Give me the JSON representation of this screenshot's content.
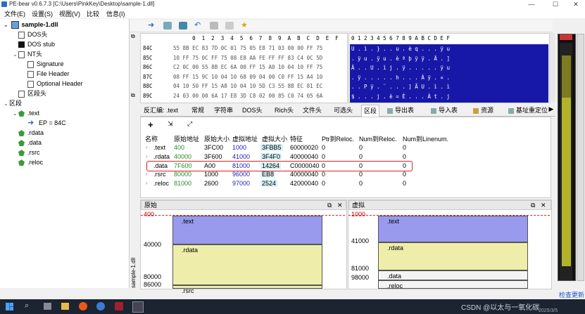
{
  "window": {
    "title": "PE-bear v0.6.7.3 [C:\\Users\\PinkKey\\Desktop\\sample-1.dll]",
    "controls": {
      "minimize": "—",
      "maximize": "☐",
      "close": "✕"
    }
  },
  "menu": [
    "文件(E)",
    "设置(S)",
    "视图(V)",
    "比较",
    "信息(I)"
  ],
  "tree": {
    "root": "sample-1.dll",
    "items": [
      {
        "label": "DOS头",
        "indent": 1,
        "icon": "file",
        "arrow": ""
      },
      {
        "label": "DOS stub",
        "indent": 1,
        "icon": "black",
        "arrow": ""
      },
      {
        "label": "NT头",
        "indent": 1,
        "icon": "file",
        "arrow": "⌄"
      },
      {
        "label": "Signature",
        "indent": 2,
        "icon": "file",
        "arrow": ""
      },
      {
        "label": "File Header",
        "indent": 2,
        "icon": "file",
        "arrow": ""
      },
      {
        "label": "Optional Header",
        "indent": 2,
        "icon": "file",
        "arrow": ""
      },
      {
        "label": "区段头",
        "indent": 1,
        "icon": "file",
        "arrow": ""
      },
      {
        "label": "区段",
        "indent": 0,
        "icon": "none",
        "arrow": "⌄"
      },
      {
        "label": ".text",
        "indent": 1,
        "icon": "green",
        "arrow": "⌄"
      },
      {
        "label": "EP = 84C",
        "indent": 2,
        "icon": "arrow",
        "arrow": ""
      },
      {
        "label": ".rdata",
        "indent": 1,
        "icon": "green",
        "arrow": ""
      },
      {
        "label": ".data",
        "indent": 1,
        "icon": "green",
        "arrow": ""
      },
      {
        "label": ".rsrc",
        "indent": 1,
        "icon": "green",
        "arrow": ""
      },
      {
        "label": ".reloc",
        "indent": 1,
        "icon": "green",
        "arrow": ""
      }
    ]
  },
  "hex": {
    "header": "      0  1  2  3  4  5  6  7  8  9  A  B  C  D  E  F",
    "rows": [
      {
        "addr": "84C",
        "bytes": "55 8B EC 83 7D 0C 01 75 05 E8 71 03 00 00 FF 75"
      },
      {
        "addr": "85C",
        "bytes": "10 FF 75 0C FF 75 08 E8 AA FE FF FF 83 C4 0C 5D"
      },
      {
        "addr": "86C",
        "bytes": "C2 0C 00 55 8B EC 6A 00 FF 15 A0 10 04 10 FF 75"
      },
      {
        "addr": "87C",
        "bytes": "08 FF 15 9C 10 04 10 68 09 04 00 C0 FF 15 A4 10"
      },
      {
        "addr": "88C",
        "bytes": "04 10 50 FF 15 A8 10 04 10 5D C3 55 8B EC 81 EC"
      },
      {
        "addr": "89C",
        "bytes": "24 03 00 00 6A 17 E8 3D C8 02 00 85 C0 74 05 6A"
      }
    ],
    "ascii_header": "0 1 2 3 4 5 6 7 8 9 A B C D E F",
    "ascii_rows": [
      "U . ì . } . . u . è q . . . ÿ u",
      ". ÿ u . ÿ u . è ª þ ÿ ÿ . Ä . ]",
      "Â . . U . ì j . ÿ . . . . . ÿ u",
      ". ÿ . . . . . h . . . À ÿ . ¤ .",
      ". . P ÿ . ¨ . . . ] Ã U . ì . ì",
      "$ . . . j . è = È . . . À t . j"
    ]
  },
  "tabs": [
    "反汇编: .text",
    "常规",
    "字符串",
    "DOS头",
    "Rich头",
    "文件头",
    "可选头",
    "区段",
    "导出表",
    "导入表",
    "资源",
    "基址重定位"
  ],
  "active_tab": "区段",
  "section_table": {
    "columns": [
      "名称",
      "原始地址",
      "原始大小",
      "虚拟地址",
      "虚拟大小",
      "特征",
      "Ptr到Reloc.",
      "Num到Reloc.",
      "Num到Linenum."
    ],
    "rows": [
      [
        ".text",
        "400",
        "3FC00",
        "1000",
        "3FBB5",
        "60000020",
        "0",
        "0",
        "0"
      ],
      [
        ".rdata",
        "40000",
        "3F600",
        "41000",
        "3F4F0",
        "40000040",
        "0",
        "0",
        "0"
      ],
      [
        ".data",
        "7F600",
        "A00",
        "81000",
        "14264",
        "C0000040",
        "0",
        "0",
        "0"
      ],
      [
        ".rsrc",
        "80000",
        "1000",
        "96000",
        "EB8",
        "40000040",
        "0",
        "0",
        "0"
      ],
      [
        ".reloc",
        "81000",
        "2600",
        "97000",
        "2524",
        "42000040",
        "0",
        "0",
        "0"
      ]
    ],
    "highlighted_row": ".data"
  },
  "raw_panel": {
    "title": "原始",
    "labels": [
      "400",
      "40000",
      "80000",
      "86000"
    ],
    "blocks": [
      ".text",
      ".rdata",
      ".rsrc"
    ]
  },
  "virtual_panel": {
    "title": "虚拟",
    "labels": [
      "1000",
      "41000",
      "81000",
      "98000"
    ],
    "blocks": [
      ".text",
      ".rdata",
      ".data",
      ".reloc"
    ]
  },
  "side_label": "sample-1.dll",
  "bottom_right_link": "检查更新",
  "taskbar": {
    "watermark": "CSDN @以太与一氧化碳",
    "date": "2025/3/5"
  },
  "colors": {
    "hex_ascii_bg": "#1818a8",
    "text_block": "#9999ee",
    "rdata_block": "#eeeeaa",
    "highlight": "#e02020",
    "raw_addr_color": "#2a8a2a",
    "virt_addr_color": "#2020c0"
  }
}
